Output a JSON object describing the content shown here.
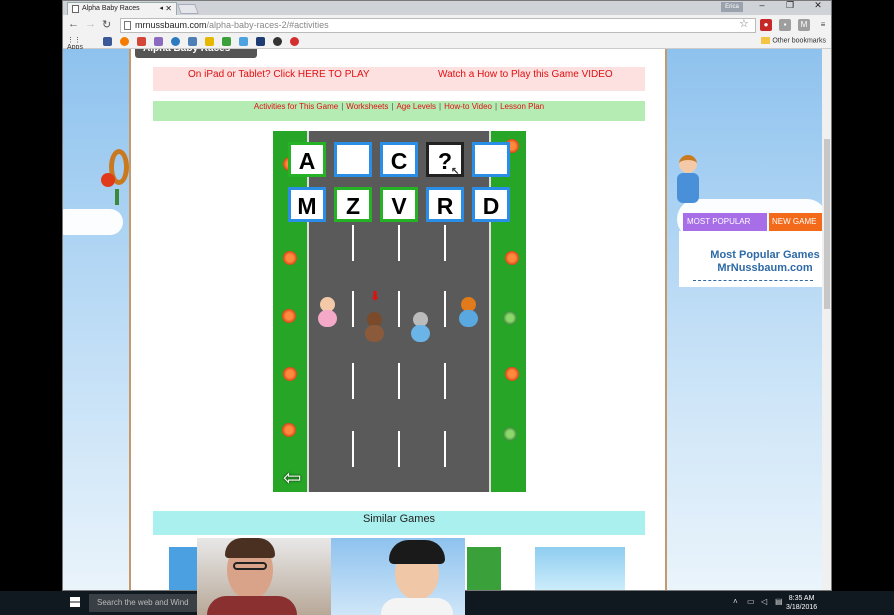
{
  "browser": {
    "tab_title": "Alpha Baby Races",
    "user_badge": "Erica",
    "url_host": "mrnussbaum.com",
    "url_path": "/alpha-baby-races-2/#activities",
    "apps_label": "Apps",
    "other_bookmarks": "Other bookmarks",
    "window_minimize": "–",
    "window_restore": "❐",
    "window_close": "✕"
  },
  "page": {
    "header_title": "Alpha Baby Races",
    "ipad_link": "On iPad or Tablet? Click HERE TO PLAY",
    "video_link": "Watch a How to Play this Game VIDEO",
    "links": [
      "Activities for This Game",
      "Worksheets",
      "Age Levels",
      "How-to Video",
      "Lesson Plan"
    ],
    "separator": "|",
    "similar_games": "Similar Games"
  },
  "game": {
    "sequence": [
      "A",
      "",
      "C",
      "?",
      ""
    ],
    "choices": [
      "M",
      "Z",
      "V",
      "R",
      "D"
    ],
    "back_arrow": "⇦"
  },
  "sidebar": {
    "tab_most_popular": "MOST POPULAR",
    "tab_new_games": "NEW GAME",
    "most_popular_title": "Most Popular Games",
    "most_popular_site": "MrNussbaum.com"
  },
  "taskbar": {
    "search_placeholder": "Search the web and Wind",
    "time": "8:35 AM",
    "date": "3/18/2016"
  },
  "colors": {
    "accent_red": "#e01010",
    "grass_green": "#26a526",
    "box_blue": "#2a8ee6",
    "box_green": "#25b325"
  }
}
